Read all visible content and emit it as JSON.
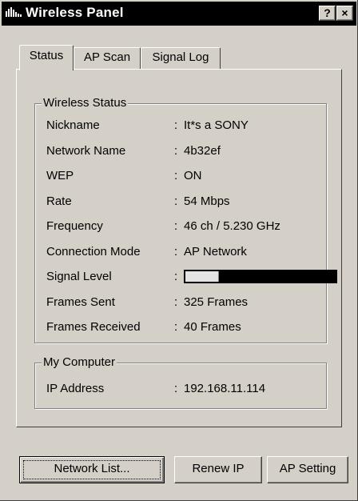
{
  "window": {
    "title": "Wireless Panel",
    "help_label": "?",
    "close_label": "×"
  },
  "tabs": [
    {
      "label": "Status",
      "active": true
    },
    {
      "label": "AP Scan",
      "active": false
    },
    {
      "label": "Signal Log",
      "active": false
    }
  ],
  "wireless_status": {
    "title": "Wireless Status",
    "rows": [
      {
        "label": "Nickname",
        "value": "It*s a SONY"
      },
      {
        "label": "Network Name",
        "value": "4b32ef"
      },
      {
        "label": "WEP",
        "value": "ON"
      },
      {
        "label": "Rate",
        "value": "54 Mbps"
      },
      {
        "label": "Frequency",
        "value": "46 ch / 5.230 GHz"
      },
      {
        "label": "Connection Mode",
        "value": "AP Network"
      },
      {
        "label": "Signal Level",
        "value": ""
      },
      {
        "label": "Frames Sent",
        "value": "325 Frames"
      },
      {
        "label": "Frames Received",
        "value": "40 Frames"
      }
    ],
    "separator": ":",
    "signal_level_fraction": 0.22
  },
  "my_computer": {
    "title": "My Computer",
    "rows": [
      {
        "label": "IP Address",
        "value": "192.168.11.114"
      }
    ]
  },
  "buttons": {
    "network_list": "Network List...",
    "renew_ip": "Renew IP",
    "ap_setting": "AP Setting"
  },
  "colors": {
    "face": "#d4d0c8",
    "titlebar": "#000000",
    "signal_empty": "#000000",
    "signal_fill": "#e4e4e4"
  }
}
